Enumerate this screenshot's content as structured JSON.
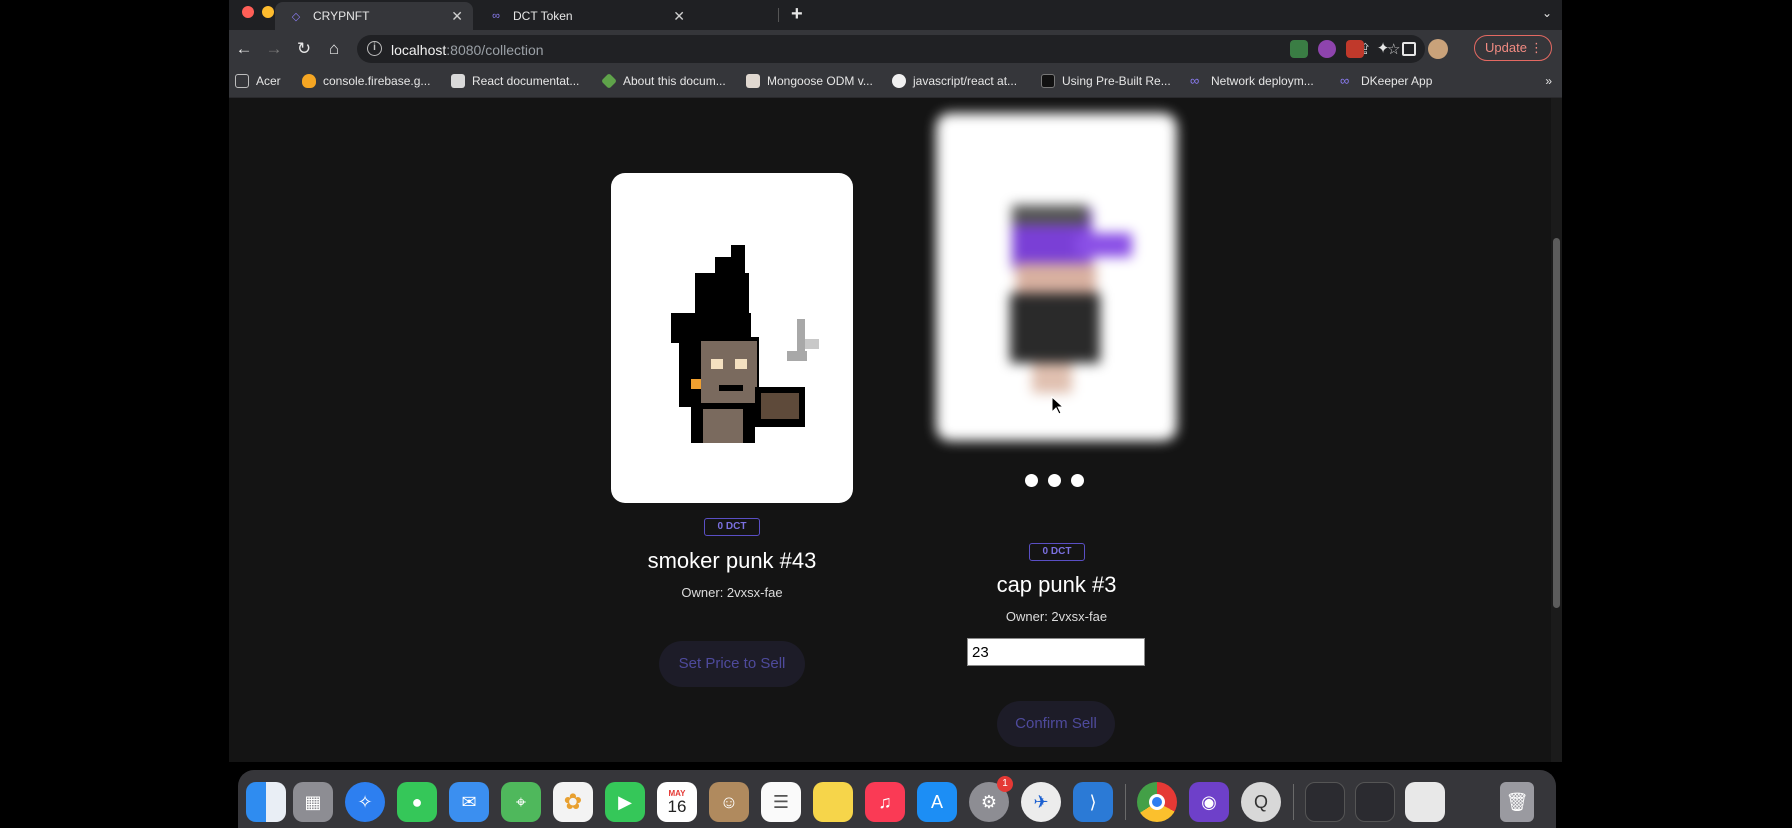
{
  "tabs": [
    {
      "label": "CRYPNFT",
      "icon": "crypnft-icon"
    },
    {
      "label": "DCT Token",
      "icon": "infinity-icon"
    }
  ],
  "toolbar": {
    "url_host": "localhost",
    "url_rest": ":8080/collection",
    "update_label": "Update"
  },
  "bookmarks": [
    "Acer",
    "console.firebase.g...",
    "React documentat...",
    "About this docum...",
    "Mongoose ODM v...",
    "javascript/react at...",
    "Using Pre-Built Re...",
    "Network deploym...",
    "DKeeper App"
  ],
  "bookmarks_more": "»",
  "nfts": [
    {
      "price": "0 DCT",
      "name": "smoker punk #43",
      "owner": "Owner: 2vxsx-fae",
      "button": "Set Price to Sell"
    },
    {
      "price": "0 DCT",
      "name": "cap punk #3",
      "owner": "Owner: 2vxsx-fae",
      "input_value": "23",
      "button": "Confirm Sell"
    }
  ],
  "dock": {
    "calendar_month": "MAY",
    "calendar_day": "16",
    "settings_badge": "1"
  },
  "colors": {
    "page_bg": "#141414",
    "badge_border": "#5a4fc4",
    "button_text": "#4e4a9c",
    "update_accent": "#f28b82"
  }
}
